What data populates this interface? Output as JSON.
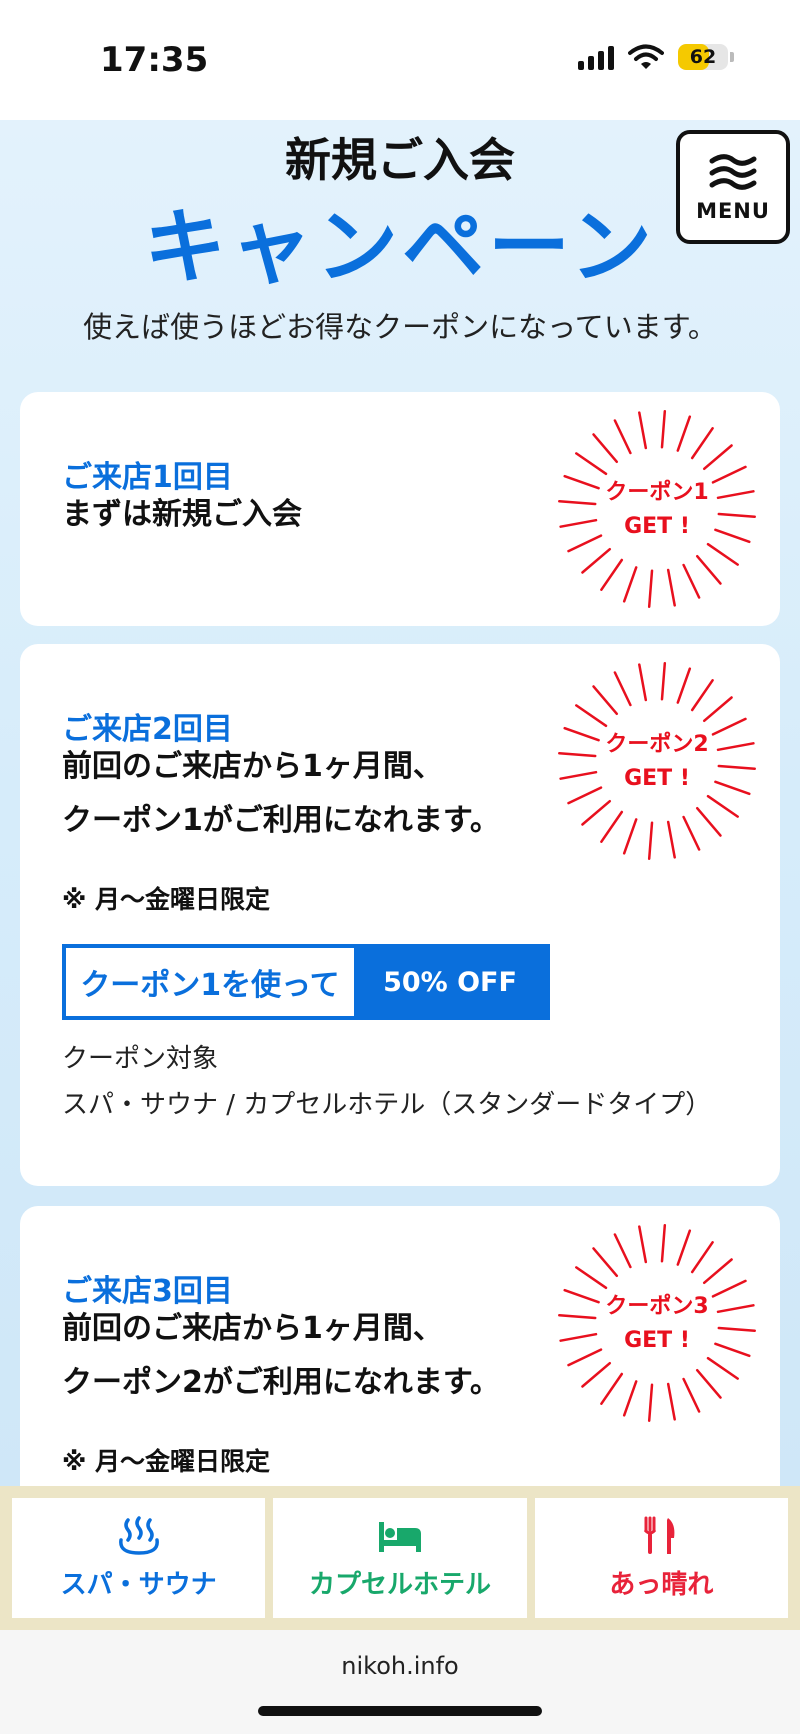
{
  "status_bar": {
    "time": "17:35",
    "battery": "62",
    "battery_level_percent": 62
  },
  "header": {
    "title": "新規ご入会",
    "campaign": "キャンペーン",
    "subtitle": "使えば使うほどお得なクーポンになっています。",
    "menu_label": "MENU"
  },
  "cards": [
    {
      "visit": "ご来店1回目",
      "desc_lines": [
        "まずは新規ご入会"
      ],
      "badge_line1": "クーポン1",
      "badge_line2": "GET !"
    },
    {
      "visit": "ご来店2回目",
      "desc_lines": [
        "前回のご来店から1ヶ月間、",
        "クーポン1がご利用になれます。"
      ],
      "note": "※ 月〜金曜日限定",
      "badge_line1": "クーポン2",
      "badge_line2": "GET !",
      "use_label": "クーポン1を使って",
      "discount": "50% OFF",
      "target_label": "クーポン対象",
      "target_value": "スパ・サウナ / カプセルホテル（スタンダードタイプ）"
    },
    {
      "visit": "ご来店3回目",
      "desc_lines": [
        "前回のご来店から1ヶ月間、",
        "クーポン2がご利用になれます。"
      ],
      "note": "※ 月〜金曜日限定",
      "badge_line1": "クーポン3",
      "badge_line2": "GET !"
    }
  ],
  "bottom_nav": [
    {
      "label": "スパ・サウナ",
      "icon": "hot-spring-icon",
      "color": "#0a6fdc"
    },
    {
      "label": "カプセルホテル",
      "icon": "bed-icon",
      "color": "#18a86b"
    },
    {
      "label": "あっ晴れ",
      "icon": "fork-knife-icon",
      "color": "#e8233a"
    }
  ],
  "browser": {
    "url": "nikoh.info"
  },
  "colors": {
    "accent_blue": "#0a6fdc",
    "burst_red": "#e8101e"
  }
}
